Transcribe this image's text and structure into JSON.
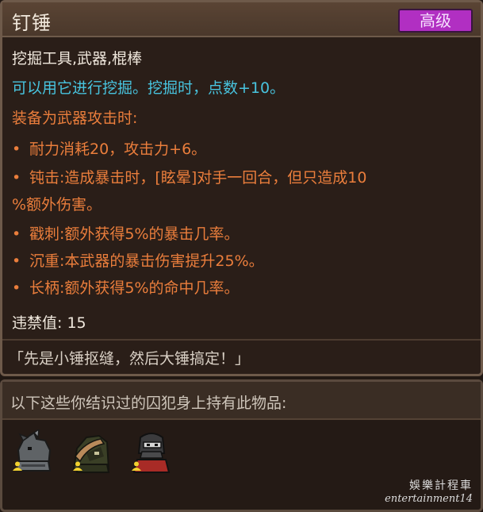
{
  "item": {
    "name": "钉锤",
    "rarity": "高级",
    "tags": "挖掘工具,武器,棍棒",
    "digging": "可以用它进行挖掘。挖掘时，点数+10。",
    "equip_header": "装备为武器攻击时:",
    "bullet": "•",
    "effects": [
      "耐力消耗20，攻击力+6。",
      "钝击:造成暴击时，[眩晕]对手一回合，但只造成10",
      "戳刺:额外获得5%的暴击几率。",
      "沉重:本武器的暴击伤害提升25%。",
      "长柄:额外获得5%的命中几率。"
    ],
    "effect_continuation": "%额外伤害。",
    "contraband": "违禁值: 15",
    "quote": "「先是小锤抠缝，然后大锤搞定！」"
  },
  "owners": {
    "label": "以下这些你结识过的囚犯身上持有此物品:",
    "portraits": [
      "rhino-prisoner-icon",
      "hooded-prisoner-icon",
      "masked-prisoner-icon"
    ]
  },
  "watermark": {
    "line1": "娛樂計程車",
    "line2": "entertainment14"
  },
  "colors": {
    "rarity": "#b12fc2",
    "cyan_text": "#48c4df",
    "orange_text": "#eb7e3c"
  }
}
